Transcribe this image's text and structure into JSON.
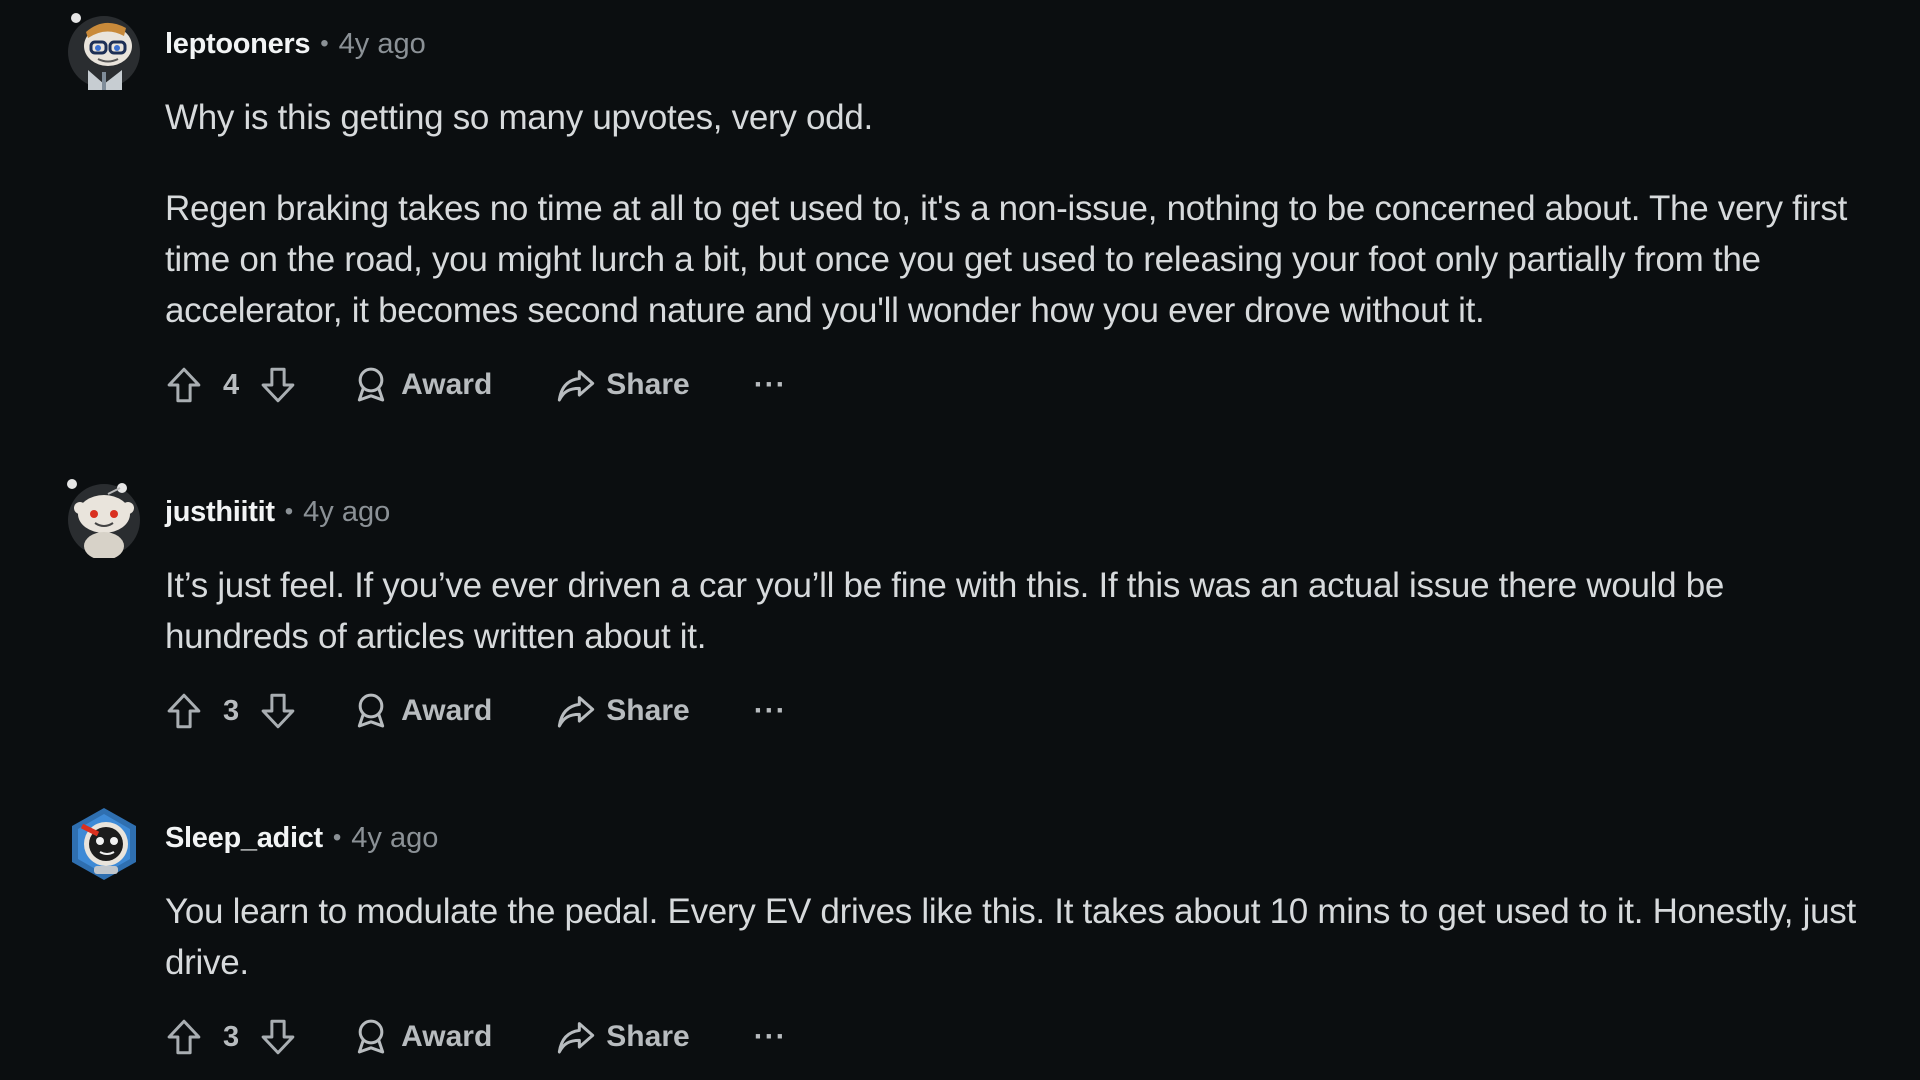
{
  "comments": [
    {
      "username": "leptooners",
      "separator": "•",
      "age": "4y ago",
      "avatar_icon": "snoo-avatar-glasses-icon",
      "paragraphs": [
        "Why is this getting so many upvotes, very odd.",
        "Regen braking takes no time at all to get used to, it's a non-issue, nothing to be concerned about. The very first time on the road, you might lurch a bit, but once you get used to releasing your foot only partially from the accelerator, it becomes second nature and you'll wonder how you ever drove without it."
      ],
      "votes": "4",
      "award_label": "Award",
      "share_label": "Share",
      "more_label": "···"
    },
    {
      "username": "justhiitit",
      "separator": "•",
      "age": "4y ago",
      "avatar_icon": "snoo-avatar-default-icon",
      "paragraphs": [
        "It’s just feel. If you’ve ever driven a car you’ll be fine with this. If this was an actual issue there would be hundreds of articles written about it."
      ],
      "votes": "3",
      "award_label": "Award",
      "share_label": "Share",
      "more_label": "···"
    },
    {
      "username": "Sleep_adict",
      "separator": "•",
      "age": "4y ago",
      "avatar_icon": "snoo-avatar-space-helmet-icon",
      "paragraphs": [
        "You learn to modulate the pedal. Every EV drives like this. It takes about 10 mins to get used to it. Honestly, just drive."
      ],
      "votes": "3",
      "award_label": "Award",
      "share_label": "Share",
      "more_label": "···"
    }
  ],
  "colors": {
    "background": "#0b0e10",
    "text": "#d7dadc",
    "username": "#f2f4f5",
    "muted": "#8b9196",
    "action": "#b8bcbf"
  },
  "icons": {
    "upvote": "upvote-arrow-icon",
    "downvote": "downvote-arrow-icon",
    "award": "award-ribbon-icon",
    "share": "share-arrow-icon"
  }
}
